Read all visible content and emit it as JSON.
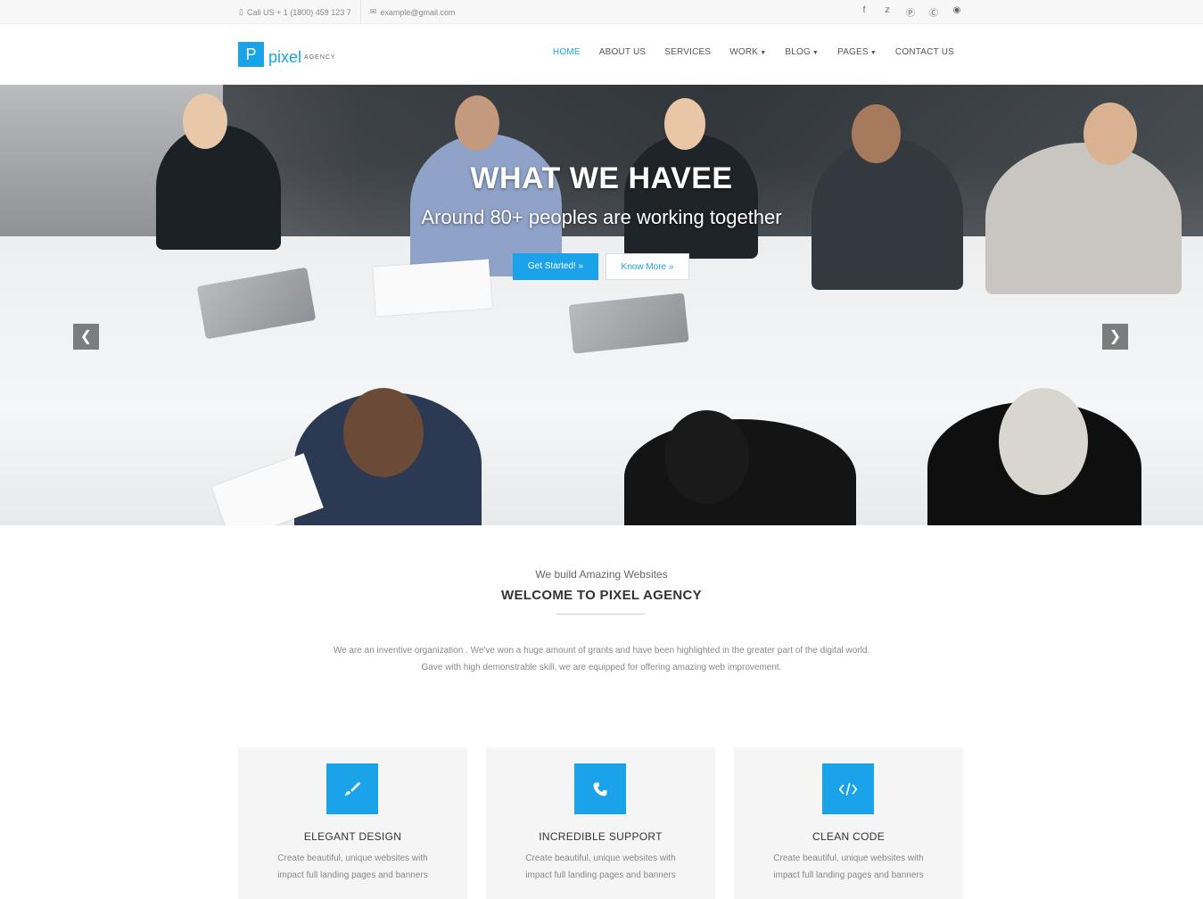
{
  "topbar": {
    "phone": "Call US + 1 (1800) 459 123 7",
    "email": "example@gmail.com",
    "social": [
      "facebook-icon",
      "twitter-icon",
      "pinterest-icon",
      "skype-icon",
      "dribbble-icon"
    ]
  },
  "brand": {
    "letter": "P",
    "name": "pixel",
    "tagline": "AGENCY",
    "color": "#1aa3e8"
  },
  "nav": {
    "items": [
      {
        "label": "HOME",
        "active": true
      },
      {
        "label": "ABOUT US"
      },
      {
        "label": "SERVICES"
      },
      {
        "label": "WORK",
        "dropdown": true
      },
      {
        "label": "BLOG",
        "dropdown": true
      },
      {
        "label": "PAGES",
        "dropdown": true
      },
      {
        "label": "CONTACT US"
      }
    ]
  },
  "hero": {
    "title": "WHAT WE HAVEE",
    "subtitle": "Around 80+ peoples are working together",
    "primary_button": "Get Started! »",
    "secondary_button": "Know More »",
    "slides": 3,
    "active_slide": 2
  },
  "intro": {
    "kicker": "We build Amazing Websites",
    "title": "WELCOME TO PIXEL AGENCY",
    "line1": "We are an inventive organization . We've won a huge amount of grants and have been highlighted in the greater part of the digital world.",
    "line2": "Gave with high demonstrable skill, we are equipped for offering amazing web improvement."
  },
  "features": [
    {
      "icon": "paint-brush-icon",
      "title": "ELEGANT DESIGN",
      "text": "Create beautiful, unique websites with impact full landing pages and banners"
    },
    {
      "icon": "phone-icon",
      "title": "INCREDIBLE SUPPORT",
      "text": "Create beautiful, unique websites with impact full landing pages and banners"
    },
    {
      "icon": "code-icon",
      "title": "CLEAN CODE",
      "text": "Create beautiful, unique websites with impact full landing pages and banners"
    }
  ]
}
